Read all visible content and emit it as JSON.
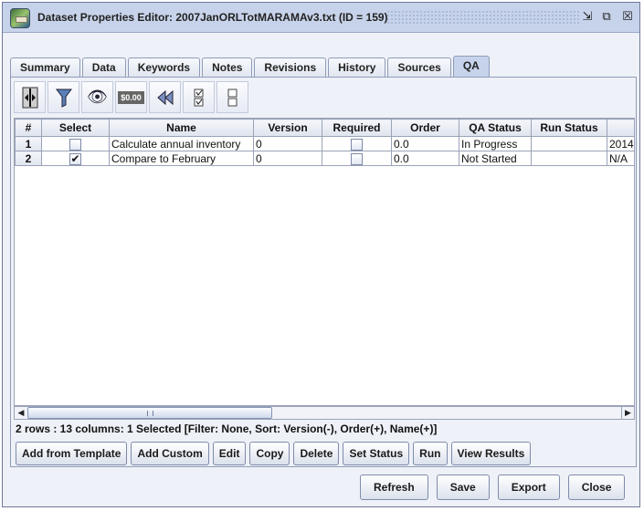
{
  "window": {
    "title": "Dataset Properties Editor: 2007JanORLTotMARAMAv3.txt (ID = 159)",
    "controls": [
      "minimize-icon",
      "maximize-icon",
      "close-icon"
    ]
  },
  "tabs": [
    {
      "label": "Summary",
      "active": false
    },
    {
      "label": "Data",
      "active": false
    },
    {
      "label": "Keywords",
      "active": false
    },
    {
      "label": "Notes",
      "active": false
    },
    {
      "label": "Revisions",
      "active": false
    },
    {
      "label": "History",
      "active": false
    },
    {
      "label": "Sources",
      "active": false
    },
    {
      "label": "QA",
      "active": true
    }
  ],
  "toolbar": {
    "dollar_label": "$0.00",
    "icons": [
      "column-resize-icon",
      "filter-icon",
      "view-eye-icon",
      "format-dollar-icon",
      "reset-rewind-icon",
      "select-all-checkbox-icon",
      "clear-selection-checkbox-icon"
    ]
  },
  "table": {
    "columns": [
      "#",
      "Select",
      "Name",
      "Version",
      "Required",
      "Order",
      "QA Status",
      "Run Status",
      ""
    ],
    "rows": [
      {
        "num": "1",
        "select": false,
        "name": "Calculate annual inventory",
        "version": "0",
        "required": false,
        "order": "0.0",
        "qa_status": "In Progress",
        "run_status": "",
        "extra": "2014"
      },
      {
        "num": "2",
        "select": true,
        "name": "Compare to February",
        "version": "0",
        "required": false,
        "order": "0.0",
        "qa_status": "Not Started",
        "run_status": "",
        "extra": "N/A"
      }
    ]
  },
  "status_text": "2 rows : 13 columns: 1 Selected [Filter: None, Sort: Version(-), Order(+), Name(+)]",
  "actions": {
    "add_from_template": "Add from Template",
    "add_custom": "Add Custom",
    "edit": "Edit",
    "copy": "Copy",
    "delete": "Delete",
    "set_status": "Set Status",
    "run": "Run",
    "view_results": "View Results"
  },
  "footer": {
    "refresh": "Refresh",
    "save": "Save",
    "export": "Export",
    "close": "Close"
  }
}
